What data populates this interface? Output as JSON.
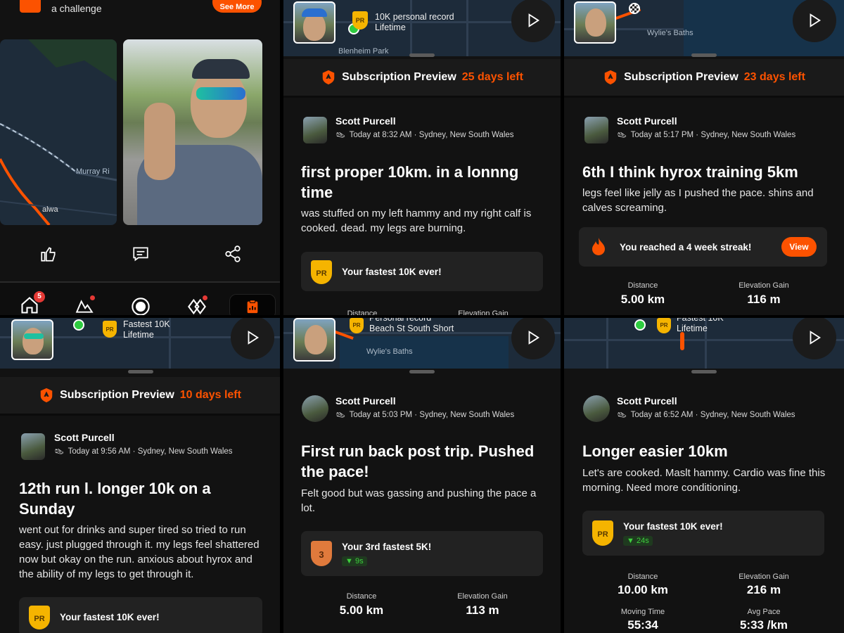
{
  "panel1": {
    "challenge_text": "a challenge",
    "see_more": "See More",
    "map_road_label": "Murray Ri",
    "map_place_label": "alwa",
    "nav_badge": "5"
  },
  "panel2": {
    "map_label_line1": "10K personal record",
    "map_label_line2": "Lifetime",
    "map_place": "Blenheim Park",
    "sub_prefix": "Subscription Preview",
    "sub_days": "25 days left",
    "name": "Scott Purcell",
    "meta": "Today at 8:32 AM · Sydney, New South Wales",
    "title": "first proper 10km. in a lonnng time",
    "desc": "was stuffed on my left hammy and my right calf is cooked. dead. my legs are burning.",
    "card_text": "Your fastest 10K ever!",
    "stat1_label": "Distance",
    "stat2_label": "Elevation Gain"
  },
  "panel3": {
    "map_place": "Wylie's Baths",
    "sub_prefix": "Subscription Preview",
    "sub_days": "23 days left",
    "name": "Scott Purcell",
    "meta": "Today at 5:17 PM · Sydney, New South Wales",
    "title": "6th I think hyrox training 5km",
    "desc": "legs feel like jelly as I pushed the pace. shins and calves screaming.",
    "streak_text": "You reached a 4 week streak!",
    "view_label": "View",
    "stat1_label": "Distance",
    "stat1_value": "5.00 km",
    "stat2_label": "Elevation Gain",
    "stat2_value": "116 m"
  },
  "panel4": {
    "map_label_line1": "Fastest 10K",
    "map_label_line2": "Lifetime",
    "sub_prefix": "Subscription Preview",
    "sub_days": "10 days left",
    "name": "Scott Purcell",
    "meta": "Today at 9:56 AM · Sydney, New South Wales",
    "title": "12th run l. longer 10k on a Sunday",
    "desc": "went out for drinks and super tired so tried to run easy. just plugged through it. my legs feel shattered now but okay on the run. anxious about hyrox and the ability of my legs to get through it.",
    "card_text": "Your fastest 10K ever!"
  },
  "panel5": {
    "map_label_line1": "Personal record",
    "map_label_line2": "Beach St South Short",
    "map_place": "Wylie's Baths",
    "name": "Scott Purcell",
    "meta": "Today at 5:03 PM · Sydney, New South Wales",
    "title": "First run back post trip. Pushed the pace!",
    "desc": "Felt good but was gassing and pushing the pace a lot.",
    "card_text": "Your 3rd fastest 5K!",
    "card_chip": "9s",
    "medal_num": "3",
    "stat1_label": "Distance",
    "stat1_value": "5.00 km",
    "stat2_label": "Elevation Gain",
    "stat2_value": "113 m"
  },
  "panel6": {
    "map_label_line1": "Fastest 10K",
    "map_label_line2": "Lifetime",
    "name": "Scott Purcell",
    "meta": "Today at 6:52 AM · Sydney, New South Wales",
    "title": "Longer easier 10km",
    "desc": "Let's are cooked. Maslt hammy. Cardio was fine this morning. Need more conditioning.",
    "card_text": "Your fastest 10K ever!",
    "card_chip": "24s",
    "stat1_label": "Distance",
    "stat1_value": "10.00 km",
    "stat2_label": "Elevation Gain",
    "stat2_value": "216 m",
    "stat3_label": "Moving Time",
    "stat3_value": "55:34",
    "stat4_label": "Avg Pace",
    "stat4_value": "5:33 /km"
  },
  "pr_badge_text": "PR",
  "colors": {
    "accent": "#fc5200",
    "gold": "#f5b400",
    "bg": "#121212",
    "card": "#222222",
    "map": "#1d2b3a"
  }
}
